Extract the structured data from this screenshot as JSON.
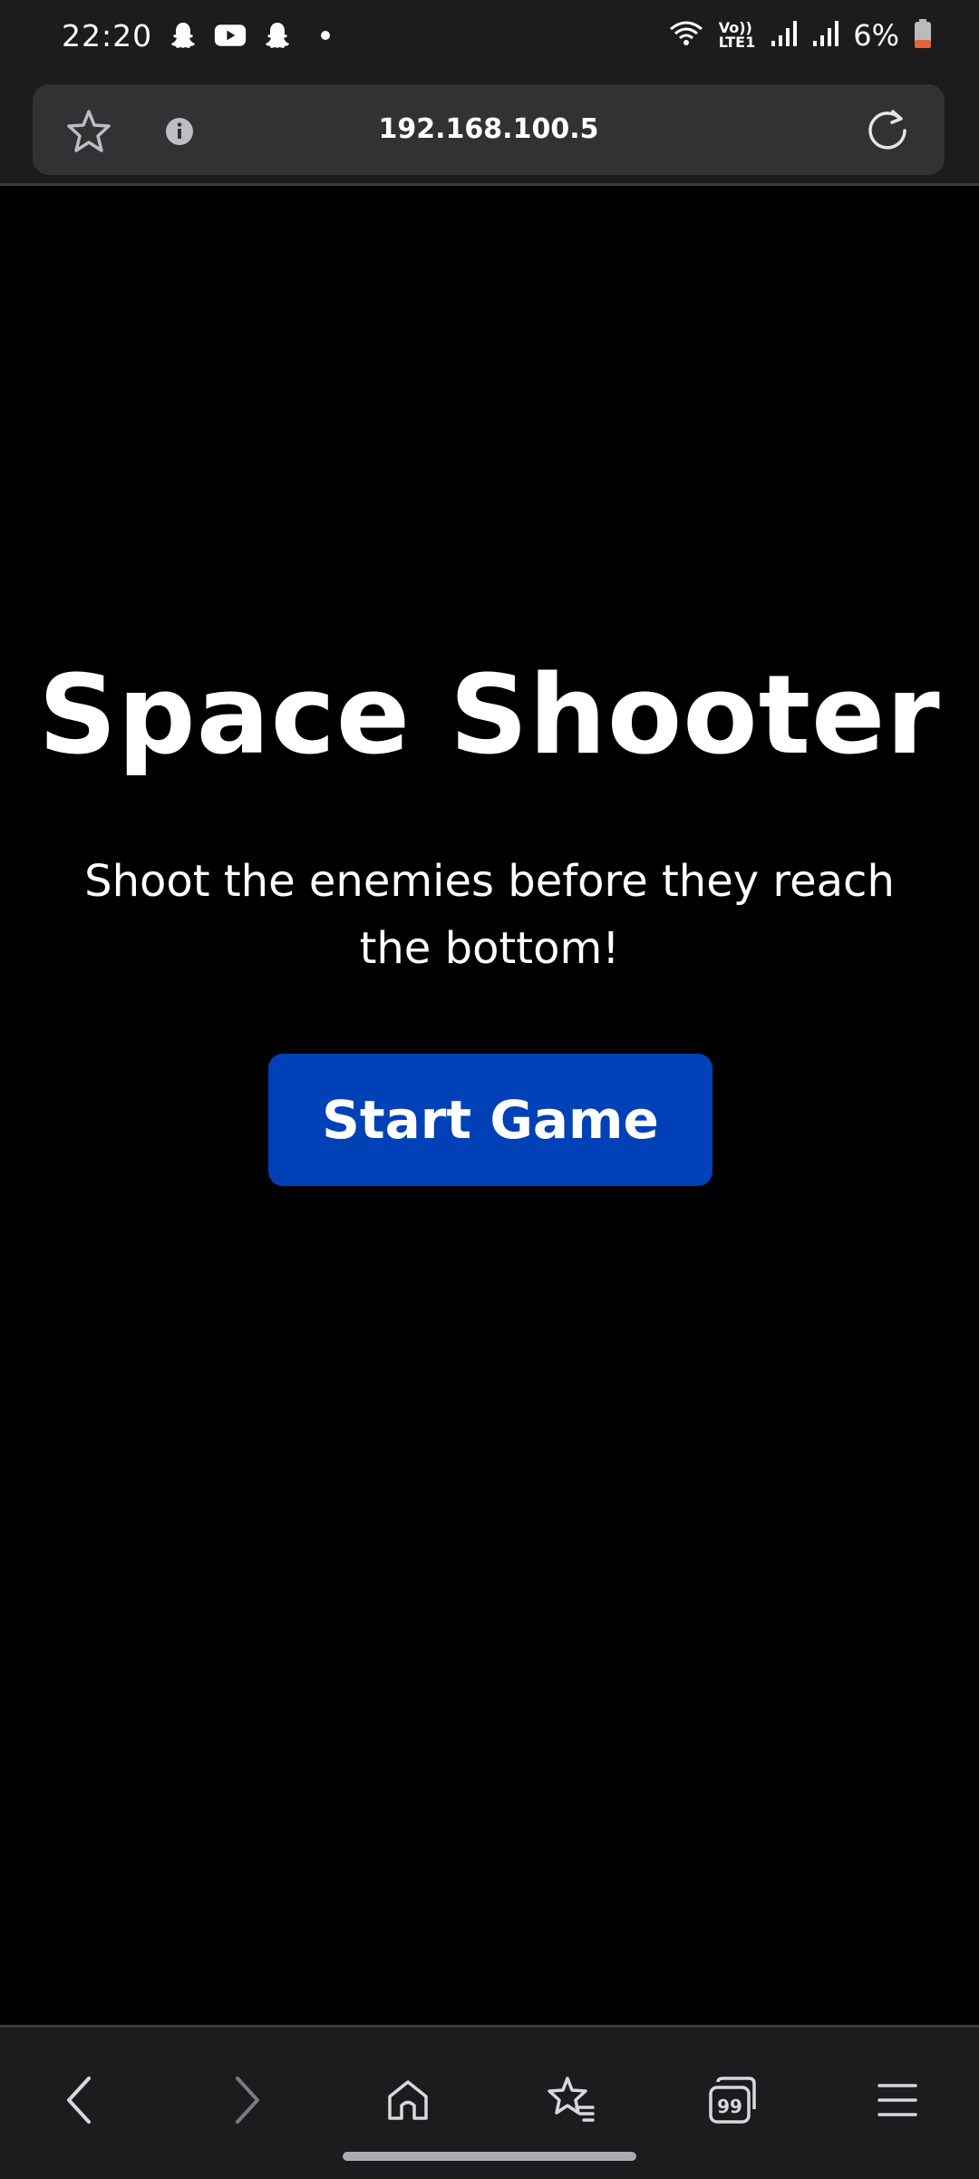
{
  "status_bar": {
    "time": "22:20",
    "battery": "6%",
    "network_label_top": "Vo))",
    "network_label_bottom": "LTE1",
    "icons": [
      "snapchat-icon",
      "youtube-icon",
      "snapchat-icon",
      "dot-icon",
      "wifi-icon",
      "signal-icon",
      "signal-icon",
      "battery-icon"
    ],
    "battery_level": 0.06,
    "battery_color": "#e8623a"
  },
  "browser": {
    "url": "192.168.100.5",
    "icons": [
      "star-icon",
      "info-icon",
      "reload-icon"
    ]
  },
  "game": {
    "title": "Space Shooter",
    "subtitle": "Shoot the enemies before they reach the bottom!",
    "start_button_label": "Start Game",
    "button_color": "#0041b8"
  },
  "bottom_nav": {
    "icons": [
      "back-icon",
      "forward-icon",
      "home-icon",
      "bookmarks-icon",
      "tabs-icon",
      "menu-icon"
    ],
    "tabs_count": "99"
  }
}
